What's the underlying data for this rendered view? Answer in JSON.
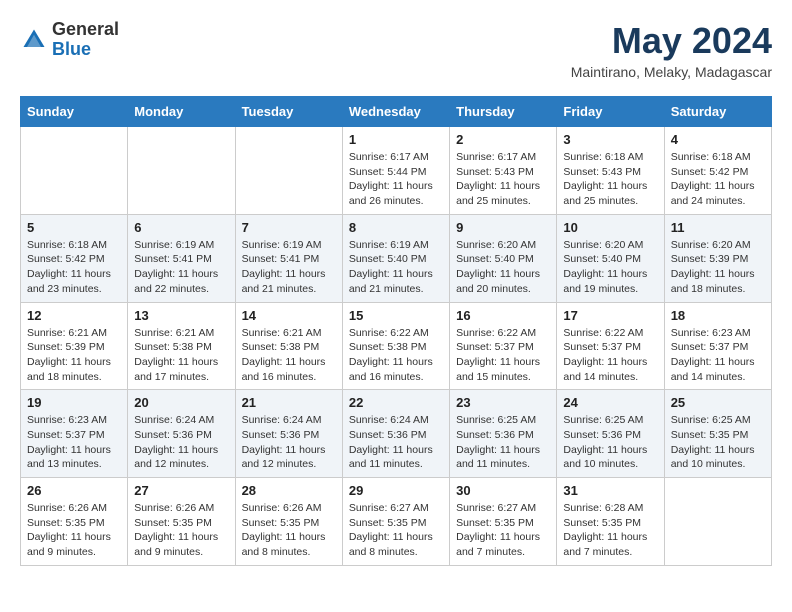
{
  "header": {
    "logo_general": "General",
    "logo_blue": "Blue",
    "month_title": "May 2024",
    "location": "Maintirano, Melaky, Madagascar"
  },
  "weekdays": [
    "Sunday",
    "Monday",
    "Tuesday",
    "Wednesday",
    "Thursday",
    "Friday",
    "Saturday"
  ],
  "weeks": [
    [
      {
        "day": "",
        "sunrise": "",
        "sunset": "",
        "daylight": ""
      },
      {
        "day": "",
        "sunrise": "",
        "sunset": "",
        "daylight": ""
      },
      {
        "day": "",
        "sunrise": "",
        "sunset": "",
        "daylight": ""
      },
      {
        "day": "1",
        "sunrise": "Sunrise: 6:17 AM",
        "sunset": "Sunset: 5:44 PM",
        "daylight": "Daylight: 11 hours and 26 minutes."
      },
      {
        "day": "2",
        "sunrise": "Sunrise: 6:17 AM",
        "sunset": "Sunset: 5:43 PM",
        "daylight": "Daylight: 11 hours and 25 minutes."
      },
      {
        "day": "3",
        "sunrise": "Sunrise: 6:18 AM",
        "sunset": "Sunset: 5:43 PM",
        "daylight": "Daylight: 11 hours and 25 minutes."
      },
      {
        "day": "4",
        "sunrise": "Sunrise: 6:18 AM",
        "sunset": "Sunset: 5:42 PM",
        "daylight": "Daylight: 11 hours and 24 minutes."
      }
    ],
    [
      {
        "day": "5",
        "sunrise": "Sunrise: 6:18 AM",
        "sunset": "Sunset: 5:42 PM",
        "daylight": "Daylight: 11 hours and 23 minutes."
      },
      {
        "day": "6",
        "sunrise": "Sunrise: 6:19 AM",
        "sunset": "Sunset: 5:41 PM",
        "daylight": "Daylight: 11 hours and 22 minutes."
      },
      {
        "day": "7",
        "sunrise": "Sunrise: 6:19 AM",
        "sunset": "Sunset: 5:41 PM",
        "daylight": "Daylight: 11 hours and 21 minutes."
      },
      {
        "day": "8",
        "sunrise": "Sunrise: 6:19 AM",
        "sunset": "Sunset: 5:40 PM",
        "daylight": "Daylight: 11 hours and 21 minutes."
      },
      {
        "day": "9",
        "sunrise": "Sunrise: 6:20 AM",
        "sunset": "Sunset: 5:40 PM",
        "daylight": "Daylight: 11 hours and 20 minutes."
      },
      {
        "day": "10",
        "sunrise": "Sunrise: 6:20 AM",
        "sunset": "Sunset: 5:40 PM",
        "daylight": "Daylight: 11 hours and 19 minutes."
      },
      {
        "day": "11",
        "sunrise": "Sunrise: 6:20 AM",
        "sunset": "Sunset: 5:39 PM",
        "daylight": "Daylight: 11 hours and 18 minutes."
      }
    ],
    [
      {
        "day": "12",
        "sunrise": "Sunrise: 6:21 AM",
        "sunset": "Sunset: 5:39 PM",
        "daylight": "Daylight: 11 hours and 18 minutes."
      },
      {
        "day": "13",
        "sunrise": "Sunrise: 6:21 AM",
        "sunset": "Sunset: 5:38 PM",
        "daylight": "Daylight: 11 hours and 17 minutes."
      },
      {
        "day": "14",
        "sunrise": "Sunrise: 6:21 AM",
        "sunset": "Sunset: 5:38 PM",
        "daylight": "Daylight: 11 hours and 16 minutes."
      },
      {
        "day": "15",
        "sunrise": "Sunrise: 6:22 AM",
        "sunset": "Sunset: 5:38 PM",
        "daylight": "Daylight: 11 hours and 16 minutes."
      },
      {
        "day": "16",
        "sunrise": "Sunrise: 6:22 AM",
        "sunset": "Sunset: 5:37 PM",
        "daylight": "Daylight: 11 hours and 15 minutes."
      },
      {
        "day": "17",
        "sunrise": "Sunrise: 6:22 AM",
        "sunset": "Sunset: 5:37 PM",
        "daylight": "Daylight: 11 hours and 14 minutes."
      },
      {
        "day": "18",
        "sunrise": "Sunrise: 6:23 AM",
        "sunset": "Sunset: 5:37 PM",
        "daylight": "Daylight: 11 hours and 14 minutes."
      }
    ],
    [
      {
        "day": "19",
        "sunrise": "Sunrise: 6:23 AM",
        "sunset": "Sunset: 5:37 PM",
        "daylight": "Daylight: 11 hours and 13 minutes."
      },
      {
        "day": "20",
        "sunrise": "Sunrise: 6:24 AM",
        "sunset": "Sunset: 5:36 PM",
        "daylight": "Daylight: 11 hours and 12 minutes."
      },
      {
        "day": "21",
        "sunrise": "Sunrise: 6:24 AM",
        "sunset": "Sunset: 5:36 PM",
        "daylight": "Daylight: 11 hours and 12 minutes."
      },
      {
        "day": "22",
        "sunrise": "Sunrise: 6:24 AM",
        "sunset": "Sunset: 5:36 PM",
        "daylight": "Daylight: 11 hours and 11 minutes."
      },
      {
        "day": "23",
        "sunrise": "Sunrise: 6:25 AM",
        "sunset": "Sunset: 5:36 PM",
        "daylight": "Daylight: 11 hours and 11 minutes."
      },
      {
        "day": "24",
        "sunrise": "Sunrise: 6:25 AM",
        "sunset": "Sunset: 5:36 PM",
        "daylight": "Daylight: 11 hours and 10 minutes."
      },
      {
        "day": "25",
        "sunrise": "Sunrise: 6:25 AM",
        "sunset": "Sunset: 5:35 PM",
        "daylight": "Daylight: 11 hours and 10 minutes."
      }
    ],
    [
      {
        "day": "26",
        "sunrise": "Sunrise: 6:26 AM",
        "sunset": "Sunset: 5:35 PM",
        "daylight": "Daylight: 11 hours and 9 minutes."
      },
      {
        "day": "27",
        "sunrise": "Sunrise: 6:26 AM",
        "sunset": "Sunset: 5:35 PM",
        "daylight": "Daylight: 11 hours and 9 minutes."
      },
      {
        "day": "28",
        "sunrise": "Sunrise: 6:26 AM",
        "sunset": "Sunset: 5:35 PM",
        "daylight": "Daylight: 11 hours and 8 minutes."
      },
      {
        "day": "29",
        "sunrise": "Sunrise: 6:27 AM",
        "sunset": "Sunset: 5:35 PM",
        "daylight": "Daylight: 11 hours and 8 minutes."
      },
      {
        "day": "30",
        "sunrise": "Sunrise: 6:27 AM",
        "sunset": "Sunset: 5:35 PM",
        "daylight": "Daylight: 11 hours and 7 minutes."
      },
      {
        "day": "31",
        "sunrise": "Sunrise: 6:28 AM",
        "sunset": "Sunset: 5:35 PM",
        "daylight": "Daylight: 11 hours and 7 minutes."
      },
      {
        "day": "",
        "sunrise": "",
        "sunset": "",
        "daylight": ""
      }
    ]
  ]
}
